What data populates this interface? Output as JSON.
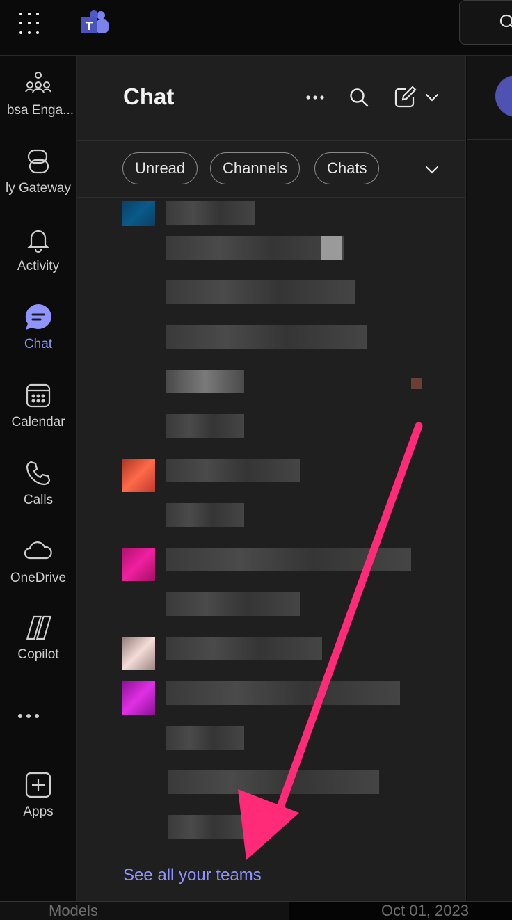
{
  "topbar": {
    "app_menu_icon": "waffle-grid-icon",
    "logo_icon": "teams-logo-icon",
    "search_icon": "search-icon"
  },
  "rail": {
    "items": [
      {
        "label": "bsa Enga...",
        "icon": "people-community-icon"
      },
      {
        "label": "ly Gateway",
        "icon": "loop-app-icon"
      },
      {
        "label": "Activity",
        "icon": "bell-icon"
      },
      {
        "label": "Chat",
        "icon": "chat-bubble-icon"
      },
      {
        "label": "Calendar",
        "icon": "calendar-icon"
      },
      {
        "label": "Calls",
        "icon": "phone-icon"
      },
      {
        "label": "OneDrive",
        "icon": "cloud-icon"
      },
      {
        "label": "Copilot",
        "icon": "copilot-icon"
      },
      {
        "label": "Apps",
        "icon": "plus-box-icon"
      }
    ],
    "active_color": "#8f94ff"
  },
  "pane": {
    "title": "Chat",
    "filters": [
      "Unread",
      "Channels",
      "Chats"
    ],
    "see_all": "See all your teams"
  },
  "bottom": {
    "left_text": "Models",
    "right_text": "Oct 01, 2023"
  },
  "colors": {
    "accent": "#8f94ff",
    "arrow": "#ff2a78",
    "pane_bg": "#1f1f1f"
  }
}
